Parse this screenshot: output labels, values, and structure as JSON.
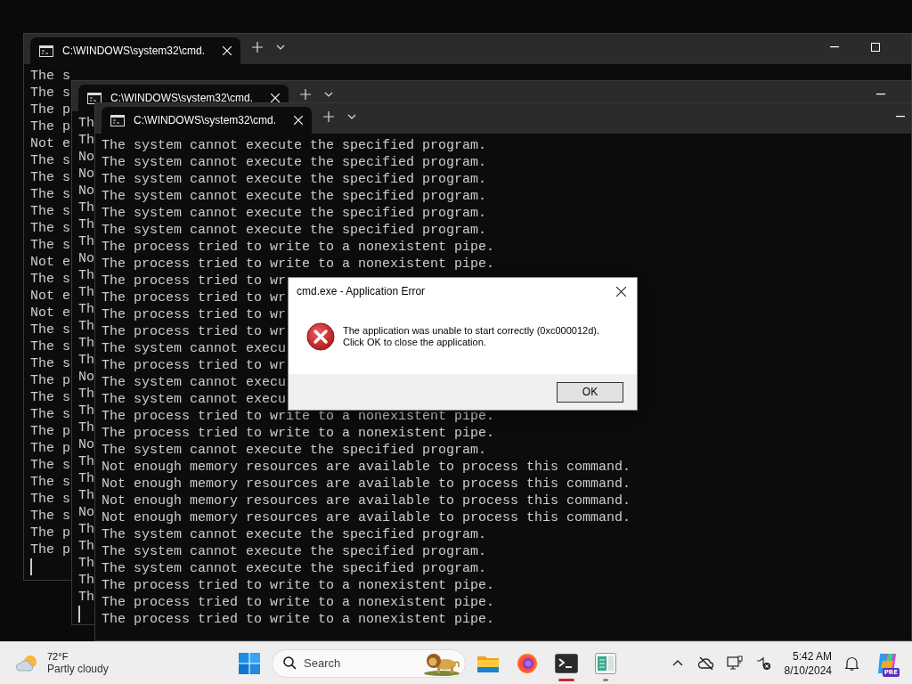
{
  "windows": [
    {
      "tab_title": "C:\\WINDOWS\\system32\\cmd.",
      "cursor": true,
      "lines": [
        "The s",
        "The s",
        "The p",
        "The p",
        "Not e",
        "The s",
        "The s",
        "The s",
        "The s",
        "The s",
        "The s",
        "Not e",
        "The s",
        "Not e",
        "Not e",
        "The s",
        "The s",
        "The s",
        "The p",
        "The s",
        "The s",
        "The p",
        "The p",
        "The s",
        "The s",
        "The s",
        "The s",
        "The p",
        "The p"
      ]
    },
    {
      "tab_title": "C:\\WINDOWS\\system32\\cmd.",
      "cursor": true,
      "lines": [
        "Th",
        "Th",
        "No",
        "No",
        "No",
        "Th",
        "Th",
        "Th",
        "No",
        "Th",
        "Th",
        "Th",
        "Th",
        "Th",
        "Th",
        "No",
        "Th",
        "Th",
        "Th",
        "No",
        "Th",
        "Th",
        "Th",
        "No",
        "Th",
        "Th",
        "Th",
        "Th",
        "Th"
      ]
    },
    {
      "tab_title": "C:\\WINDOWS\\system32\\cmd.",
      "lines": [
        "The system cannot execute the specified program.",
        "The system cannot execute the specified program.",
        "The system cannot execute the specified program.",
        "The system cannot execute the specified program.",
        "The system cannot execute the specified program.",
        "The system cannot execute the specified program.",
        "The process tried to write to a nonexistent pipe.",
        "The process tried to write to a nonexistent pipe.",
        "The process tried to wr",
        "The process tried to wr",
        "The process tried to wr",
        "The process tried to wr",
        "The system cannot execu",
        "The process tried to wr",
        "The system cannot execu",
        "The system cannot execu",
        "The process tried to write to a nonexistent pipe.",
        "The process tried to write to a nonexistent pipe.",
        "The system cannot execute the specified program.",
        "Not enough memory resources are available to process this command.",
        "Not enough memory resources are available to process this command.",
        "Not enough memory resources are available to process this command.",
        "Not enough memory resources are available to process this command.",
        "The system cannot execute the specified program.",
        "The system cannot execute the specified program.",
        "The system cannot execute the specified program.",
        "The process tried to write to a nonexistent pipe.",
        "The process tried to write to a nonexistent pipe.",
        "The process tried to write to a nonexistent pipe."
      ]
    }
  ],
  "dialog": {
    "title": "cmd.exe - Application Error",
    "message": [
      "The application was unable to start correctly (0xc000012d).",
      "Click OK to close the application."
    ],
    "buttons": [
      "OK"
    ]
  },
  "taskbar": {
    "weather": {
      "temperature": "72°F",
      "condition": "Partly cloudy"
    },
    "search": {
      "placeholder": "Search"
    },
    "apps": [
      {
        "kind": "folder",
        "active": false,
        "running": false
      },
      {
        "kind": "browser",
        "active": false,
        "running": false
      },
      {
        "kind": "terminal",
        "active": true,
        "running": true
      },
      {
        "kind": "app",
        "active": false,
        "running": true
      }
    ],
    "tray_icons": [
      {
        "kind": "chevron"
      },
      {
        "kind": "cloud-off"
      },
      {
        "kind": "network"
      },
      {
        "kind": "volume-muted"
      }
    ],
    "clock": {
      "time": "5:42 AM",
      "date": "8/10/2024"
    },
    "copilot_badge": "PRE"
  }
}
